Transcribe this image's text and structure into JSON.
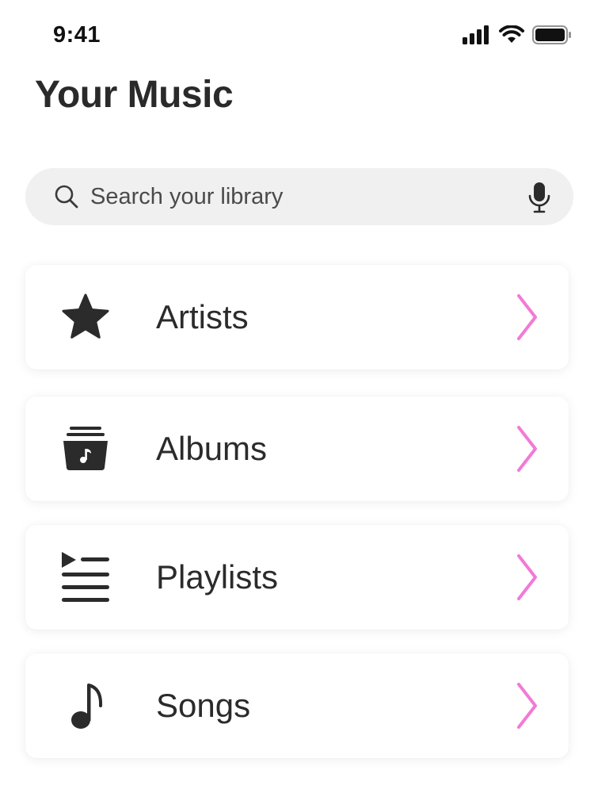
{
  "status_bar": {
    "time": "9:41",
    "icons": [
      "cellular-signal-icon",
      "wifi-icon",
      "battery-icon"
    ]
  },
  "header": {
    "title": "Your Music"
  },
  "search": {
    "placeholder": "Search your library",
    "value": "",
    "icon": "search-icon",
    "mic_icon": "microphone-icon"
  },
  "library": {
    "items": [
      {
        "label": "Artists",
        "icon": "star-icon"
      },
      {
        "label": "Albums",
        "icon": "album-stack-icon"
      },
      {
        "label": "Playlists",
        "icon": "playlist-icon"
      },
      {
        "label": "Songs",
        "icon": "music-note-icon"
      }
    ]
  },
  "colors": {
    "accent": "#f27ad6",
    "icon": "#2b2b2b",
    "search_bg": "#f0f0f0",
    "text": "#2b2b2b"
  }
}
